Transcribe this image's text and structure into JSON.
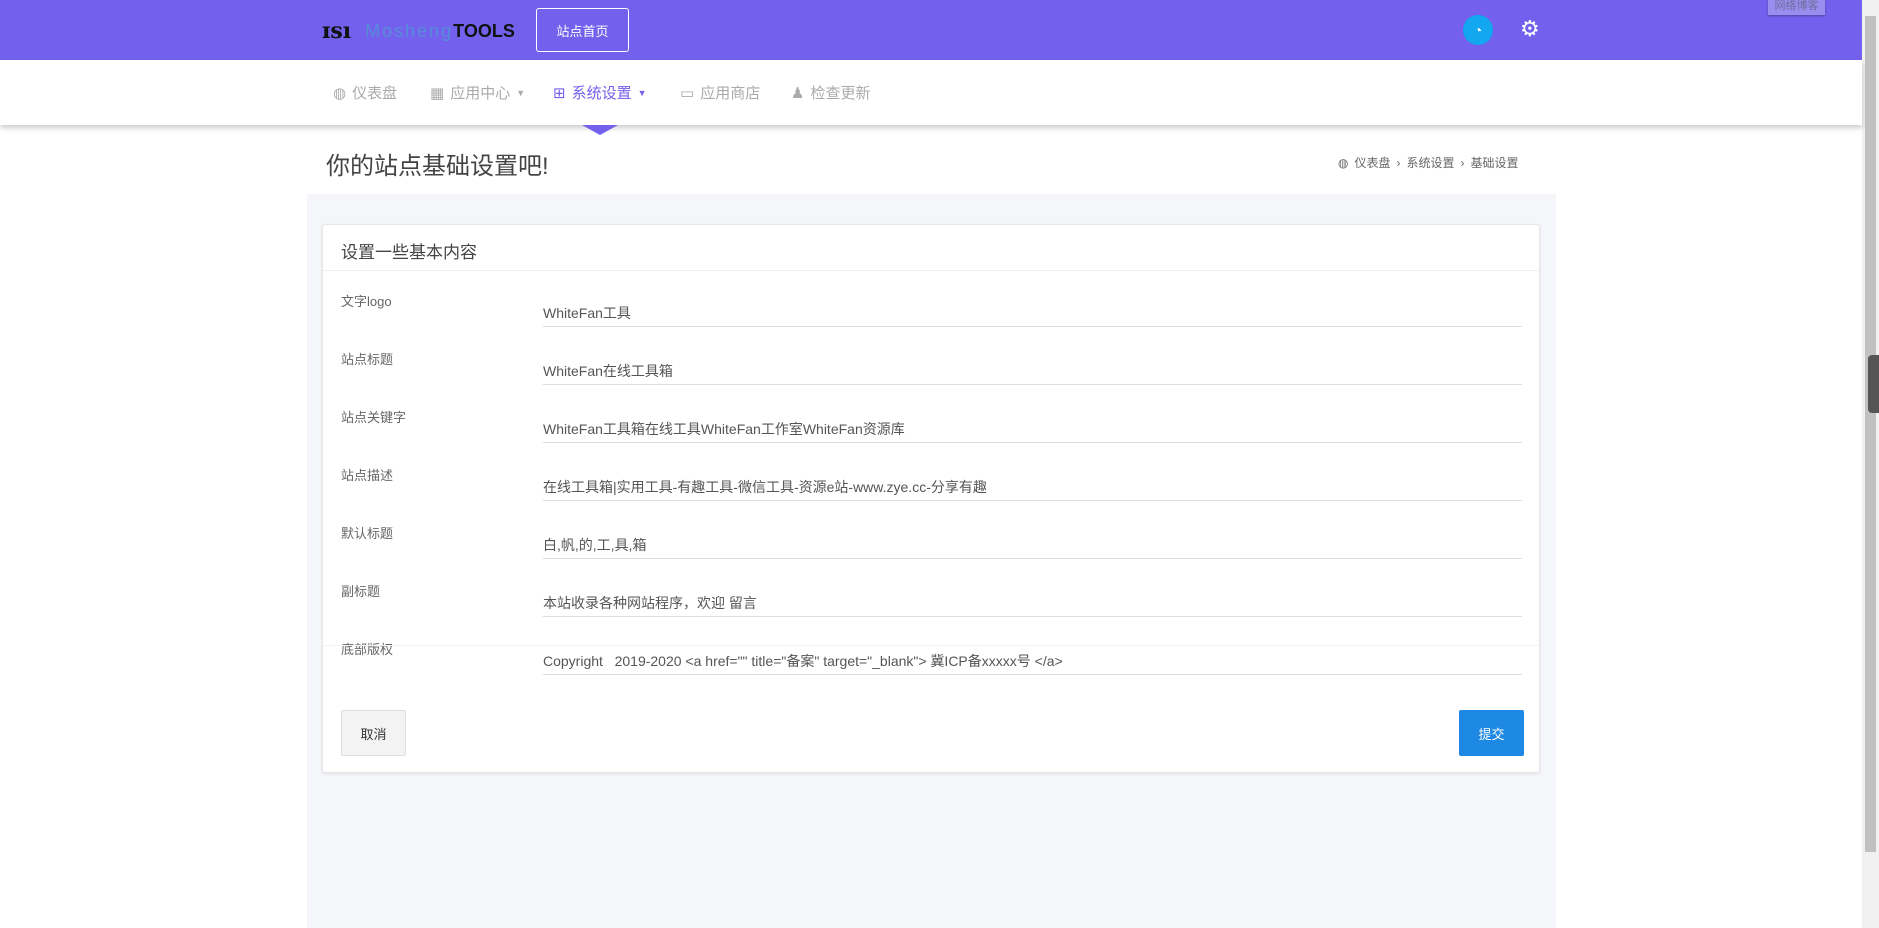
{
  "header": {
    "logo_text": "TOOLS",
    "logo_faint": "Mosheng",
    "home_button": "站点首页",
    "blog_tab": "网络博客",
    "colors": {
      "brand": "#7360ec",
      "qq": "#12a7ef"
    }
  },
  "nav": [
    {
      "label": "仪表盘",
      "icon": "dashboard-icon"
    },
    {
      "label": "应用中心",
      "icon": "grid-icon"
    },
    {
      "label": "系统设置",
      "icon": "table-icon"
    },
    {
      "label": "应用商店",
      "icon": "laptop-icon"
    },
    {
      "label": "检查更新",
      "icon": "puzzle-icon"
    }
  ],
  "page": {
    "title": "你的站点基础设置吧!",
    "breadcrumb": [
      "仪表盘",
      "系统设置",
      "基础设置"
    ]
  },
  "card": {
    "title": "设置一些基本内容",
    "fields": [
      {
        "label": "文字logo",
        "value": "WhiteFan工具"
      },
      {
        "label": "站点标题",
        "value": "WhiteFan在线工具箱"
      },
      {
        "label": "站点关键字",
        "value": "WhiteFan工具箱在线工具WhiteFan工作室WhiteFan资源库"
      },
      {
        "label": "站点描述",
        "value": "在线工具箱|实用工具-有趣工具-微信工具-资源e站-www.zye.cc-分享有趣"
      },
      {
        "label": "默认标题",
        "value": "白,帆,的,工,具,箱"
      },
      {
        "label": "副标题",
        "value": "本站收录各种网站程序，欢迎 留言"
      },
      {
        "label": "底部版权",
        "value": "Copyright   2019-2020 <a href=\"\" title=\"备案\" target=\"_blank\"> 冀ICP备xxxxx号 </a>"
      }
    ],
    "cancel": "取消",
    "submit": "提交",
    "submit_color": "#1e88e5"
  }
}
